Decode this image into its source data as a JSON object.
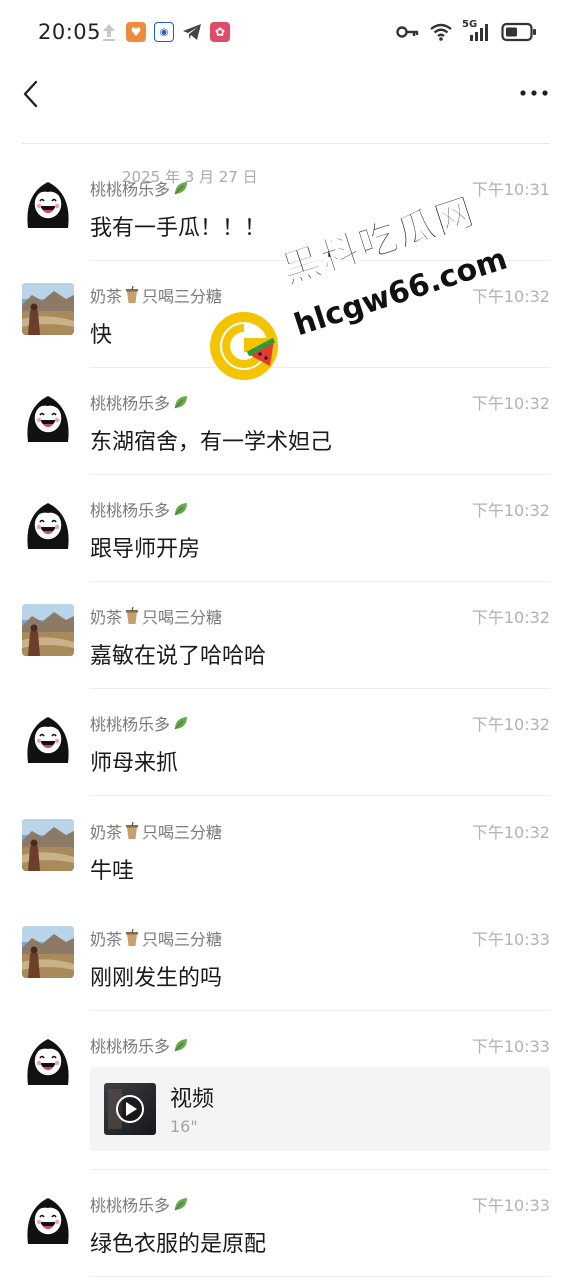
{
  "status_bar": {
    "time": "20:05",
    "network": "5G"
  },
  "nav": {
    "back_icon": "chevron-left-icon",
    "more_icon": "more-dots-icon"
  },
  "date_divider": "2025 年 3 月 27 日",
  "watermark": {
    "title": "黑料吃瓜网",
    "url": "hlcgw66.com"
  },
  "messages": [
    {
      "sender": "桃桃杨乐多",
      "avatar": "girl",
      "time": "下午10:31",
      "text": "我有一手瓜！！！"
    },
    {
      "sender": "奶茶",
      "sender_suffix": "只喝三分糖",
      "avatar": "landscape",
      "time": "下午10:32",
      "text": "快"
    },
    {
      "sender": "桃桃杨乐多",
      "avatar": "girl",
      "time": "下午10:32",
      "text": "东湖宿舍，有一学术妲己"
    },
    {
      "sender": "桃桃杨乐多",
      "avatar": "girl",
      "time": "下午10:32",
      "text": "跟导师开房"
    },
    {
      "sender": "奶茶",
      "sender_suffix": "只喝三分糖",
      "avatar": "landscape",
      "time": "下午10:32",
      "text": "嘉敏在说了哈哈哈"
    },
    {
      "sender": "桃桃杨乐多",
      "avatar": "girl",
      "time": "下午10:32",
      "text": "师母来抓"
    },
    {
      "sender": "奶茶",
      "sender_suffix": "只喝三分糖",
      "avatar": "landscape",
      "time": "下午10:32",
      "text": "牛哇"
    },
    {
      "sender": "奶茶",
      "sender_suffix": "只喝三分糖",
      "avatar": "landscape",
      "time": "下午10:33",
      "text": "刚刚发生的吗"
    },
    {
      "sender": "桃桃杨乐多",
      "avatar": "girl",
      "time": "下午10:33",
      "video": {
        "title": "视频",
        "duration": "16\""
      }
    },
    {
      "sender": "桃桃杨乐多",
      "avatar": "girl",
      "time": "下午10:33",
      "text": "绿色衣服的是原配"
    }
  ]
}
